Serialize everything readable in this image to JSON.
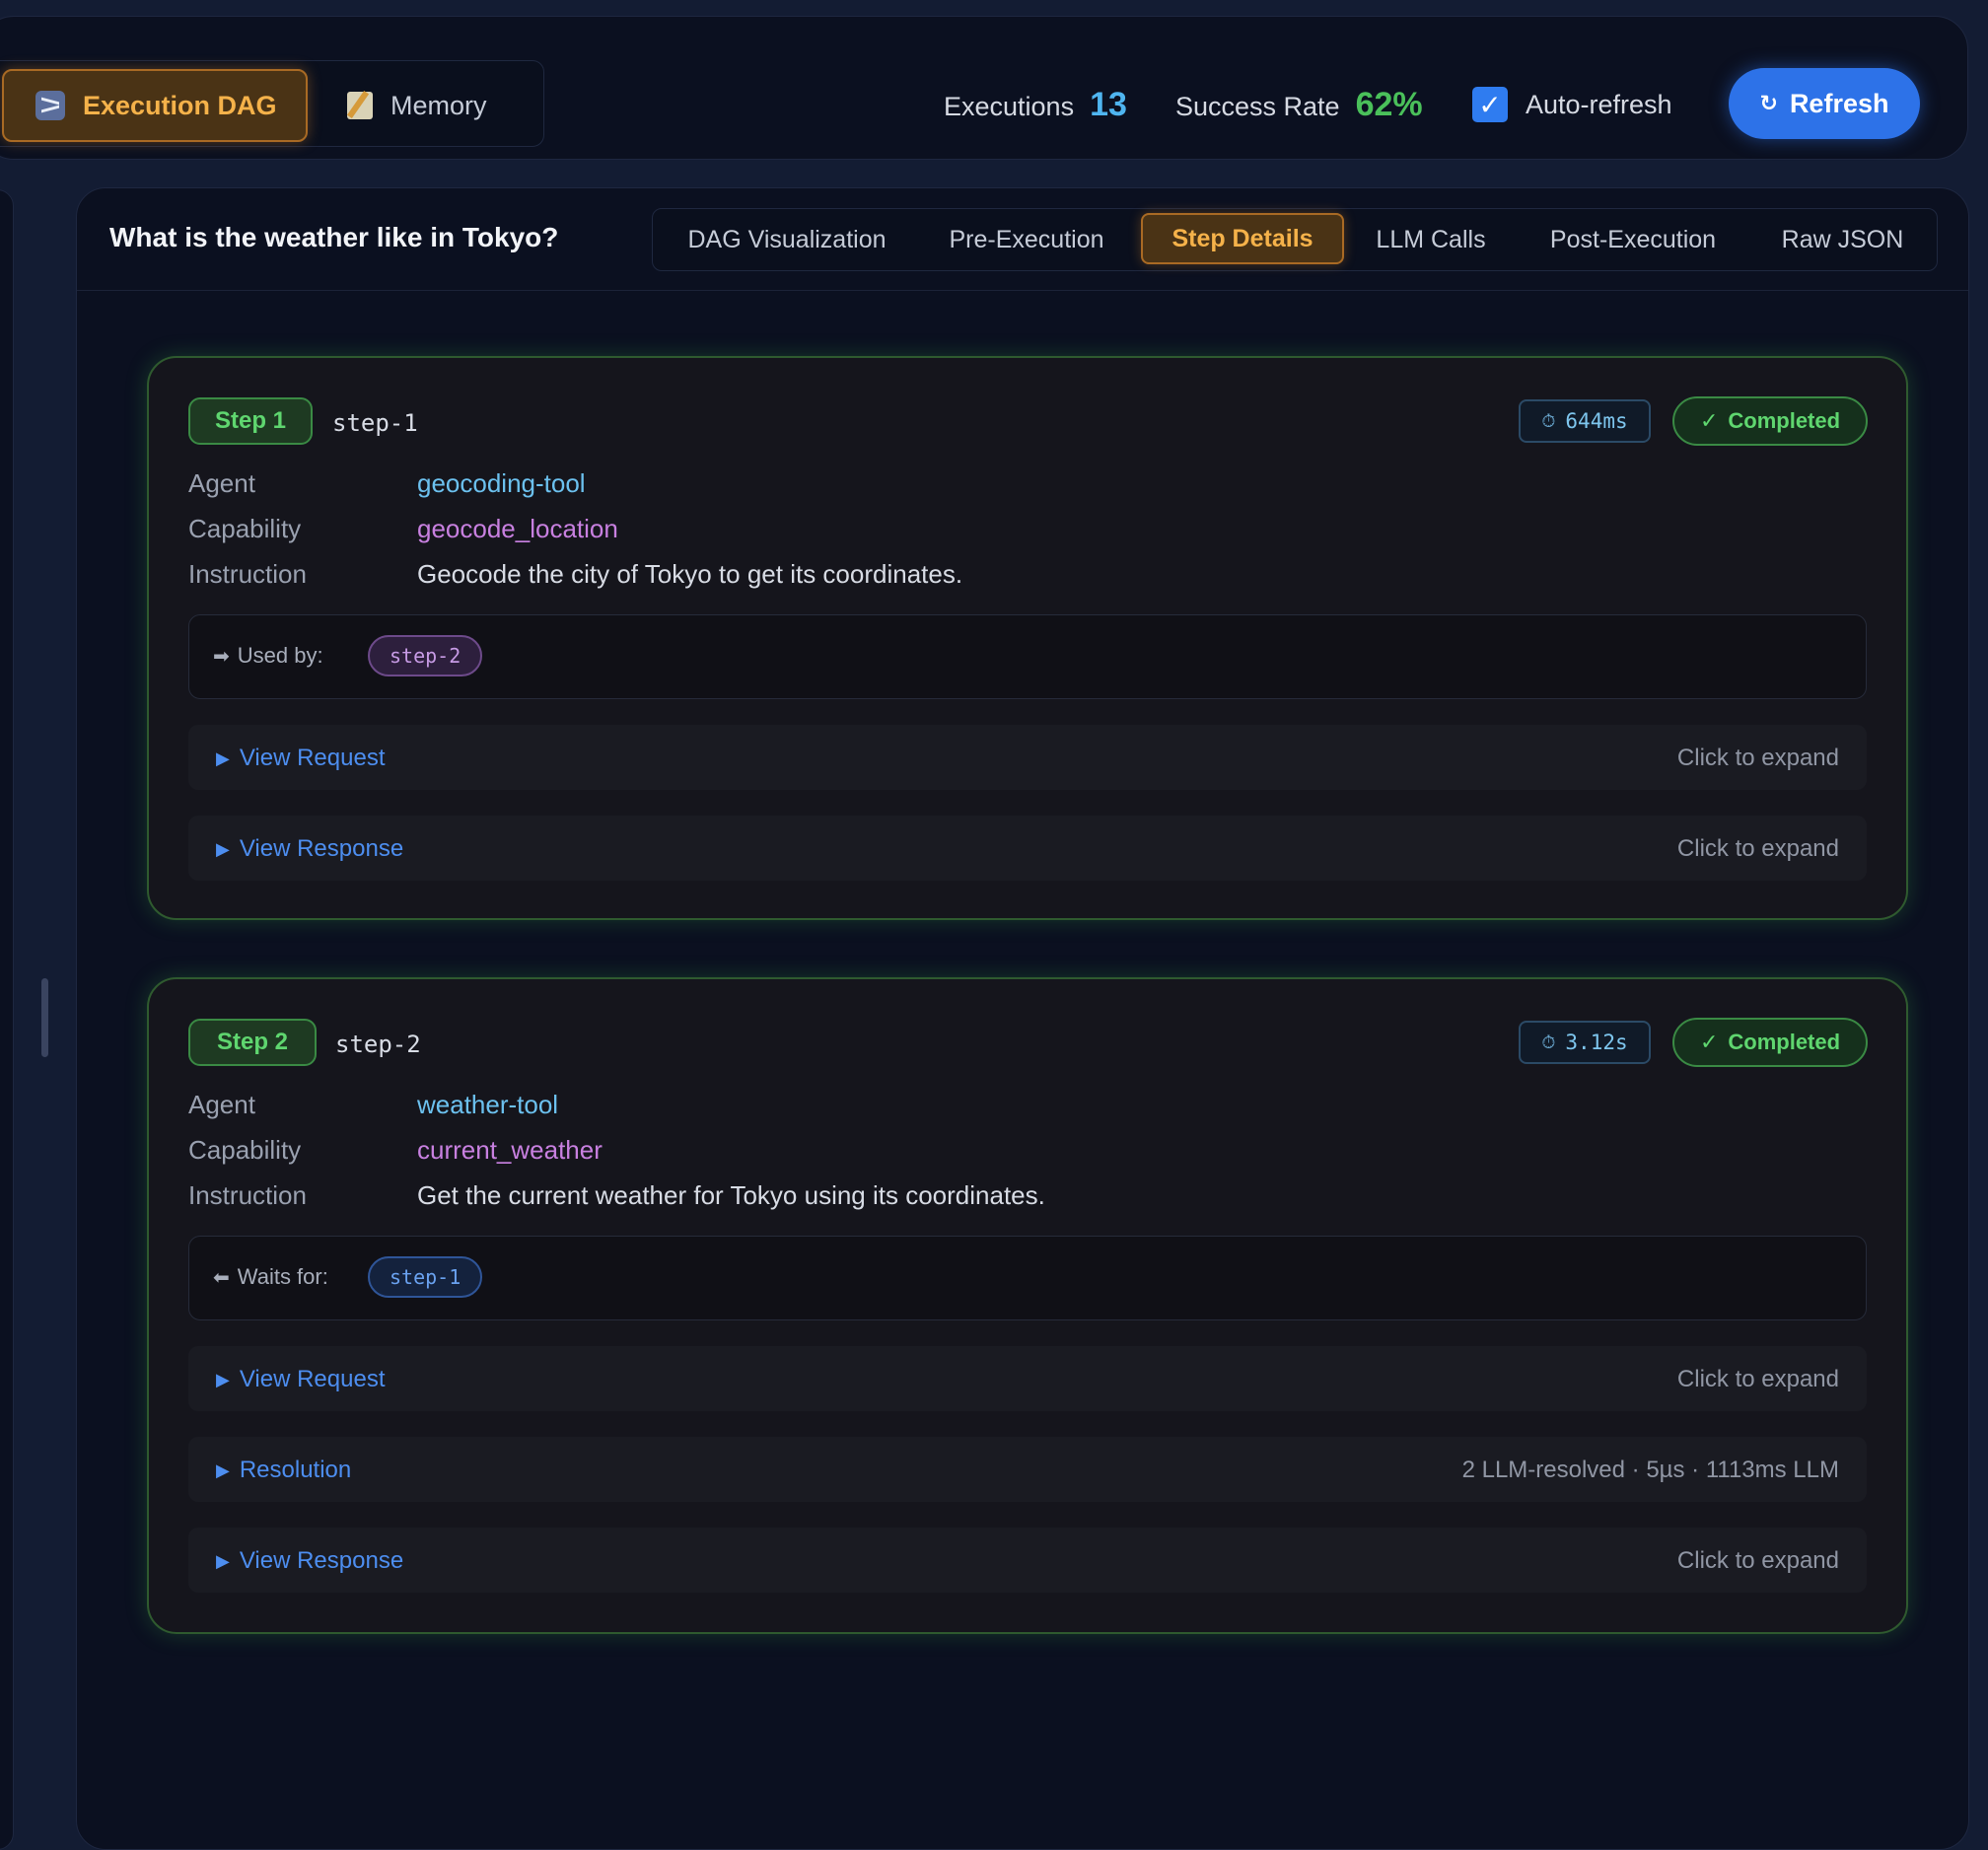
{
  "topbar": {
    "view_tabs": [
      {
        "label": "Execution DAG",
        "icon": "dag-icon",
        "active": true
      },
      {
        "label": "Memory",
        "icon": "memo-icon",
        "active": false
      }
    ],
    "executions_label": "Executions",
    "executions_value": "13",
    "success_rate_label": "Success Rate",
    "success_rate_value": "62%",
    "auto_refresh_label": "Auto-refresh",
    "auto_refresh_checked": true,
    "refresh_icon": "↻",
    "refresh_label": "Refresh"
  },
  "main": {
    "query": "What is the weather like in Tokyo?",
    "tabs": [
      {
        "label": "DAG Visualization",
        "active": false
      },
      {
        "label": "Pre-Execution",
        "active": false
      },
      {
        "label": "Step Details",
        "active": true
      },
      {
        "label": "LLM Calls",
        "active": false
      },
      {
        "label": "Post-Execution",
        "active": false
      },
      {
        "label": "Raw JSON",
        "active": false
      }
    ]
  },
  "labels": {
    "agent": "Agent",
    "capability": "Capability",
    "instruction": "Instruction",
    "used_by": "Used by:",
    "waits_for": "Waits for:",
    "click_to_expand": "Click to expand"
  },
  "steps": [
    {
      "badge": "Step 1",
      "id": "step-1",
      "duration": "644ms",
      "status": "Completed",
      "agent": "geocoding-tool",
      "capability": "geocode_location",
      "instruction": "Geocode the city of Tokyo to get its coordinates.",
      "dependency": "step-2",
      "sections": [
        {
          "title": "View Request",
          "hint": "Click to expand"
        },
        {
          "title": "View Response",
          "hint": "Click to expand"
        }
      ]
    },
    {
      "badge": "Step 2",
      "id": "step-2",
      "duration": "3.12s",
      "status": "Completed",
      "agent": "weather-tool",
      "capability": "current_weather",
      "instruction": "Get the current weather for Tokyo using its coordinates.",
      "dependency": "step-1",
      "sections": [
        {
          "title": "View Request",
          "hint": "Click to expand"
        },
        {
          "title": "Resolution",
          "hint": "2 LLM-resolved · 5µs · 1113ms LLM"
        },
        {
          "title": "View Response",
          "hint": "Click to expand"
        }
      ]
    }
  ],
  "colors": {
    "accent_orange": "#f5b24a",
    "accent_blue": "#2d72e8",
    "success_green": "#5fd66f",
    "agent_blue": "#6cc1ef",
    "capability_purple": "#c880e0"
  }
}
